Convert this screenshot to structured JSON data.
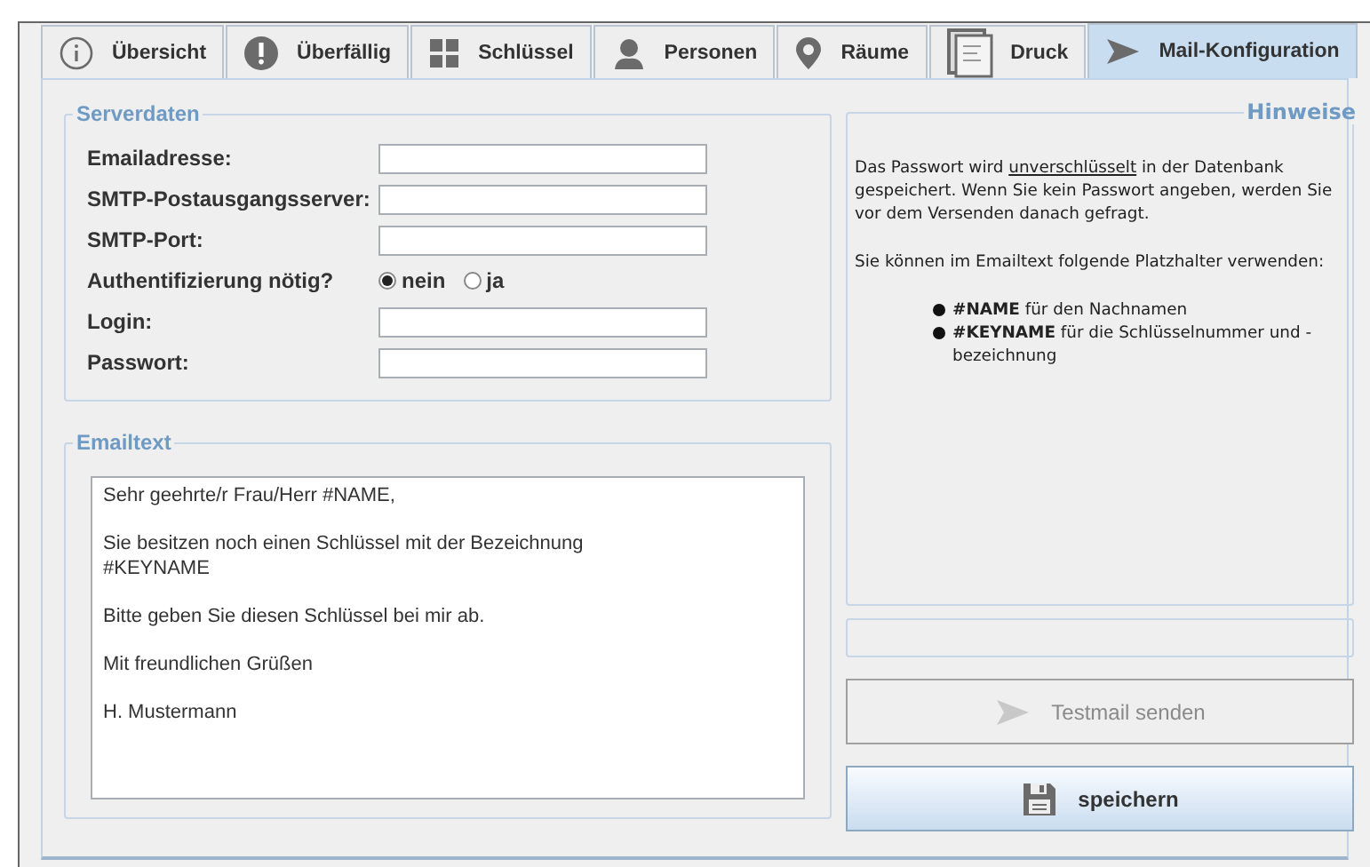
{
  "tabs": [
    {
      "label": "Übersicht",
      "selected": false
    },
    {
      "label": "Überfällig",
      "selected": false
    },
    {
      "label": "Schlüssel",
      "selected": false
    },
    {
      "label": "Personen",
      "selected": false
    },
    {
      "label": "Räume",
      "selected": false
    },
    {
      "label": "Druck",
      "selected": false
    },
    {
      "label": "Mail-Konfiguration",
      "selected": true
    }
  ],
  "server": {
    "title": "Serverdaten",
    "rows": [
      {
        "kind": "field",
        "label": "Emailadresse:"
      },
      {
        "kind": "field",
        "label": "SMTP-Postausgangsserver:"
      },
      {
        "kind": "field",
        "label": "SMTP-Port:"
      },
      {
        "kind": "radio",
        "label": "Authentifizierung nötig?",
        "options": [
          {
            "label": "nein",
            "selected": true
          },
          {
            "label": "ja",
            "selected": false
          }
        ]
      },
      {
        "kind": "field",
        "label": "Login:"
      },
      {
        "kind": "field",
        "label": "Passwort:"
      }
    ]
  },
  "email": {
    "title": "Emailtext",
    "paragraphs": [
      [
        "Sehr geehrte/r Frau/Herr #NAME,"
      ],
      [
        "Sie besitzen noch einen Schlüssel mit der Bezeichnung",
        "#KEYNAME"
      ],
      [
        "Bitte geben Sie diesen Schlüssel bei mir ab."
      ],
      [
        "Mit freundlichen Grüßen"
      ],
      [
        "H. Mustermann"
      ]
    ]
  },
  "hints": {
    "title": "Hinweise",
    "paragraphs": [
      [
        {
          "text": "Das Passwort wird ",
          "underline": false
        },
        {
          "text": "unverschlüsselt",
          "underline": true
        },
        {
          "text": " in der Datenbank gespeichert. Wenn Sie kein Passwort angeben, werden Sie vor dem Versenden danach gefragt.",
          "underline": false
        }
      ],
      [
        {
          "text": "Sie können im Emailtext folgende Platzhalter verwenden:",
          "underline": false
        }
      ]
    ],
    "bullets": [
      "**#NAME** für den Nachnamen",
      "**#KEYNAME** für die Schlüsselnummer und -bezeichnung"
    ]
  },
  "buttons": [
    {
      "label": "Testmail senden",
      "disabled": true
    },
    {
      "label": "speichern",
      "disabled": false
    }
  ]
}
